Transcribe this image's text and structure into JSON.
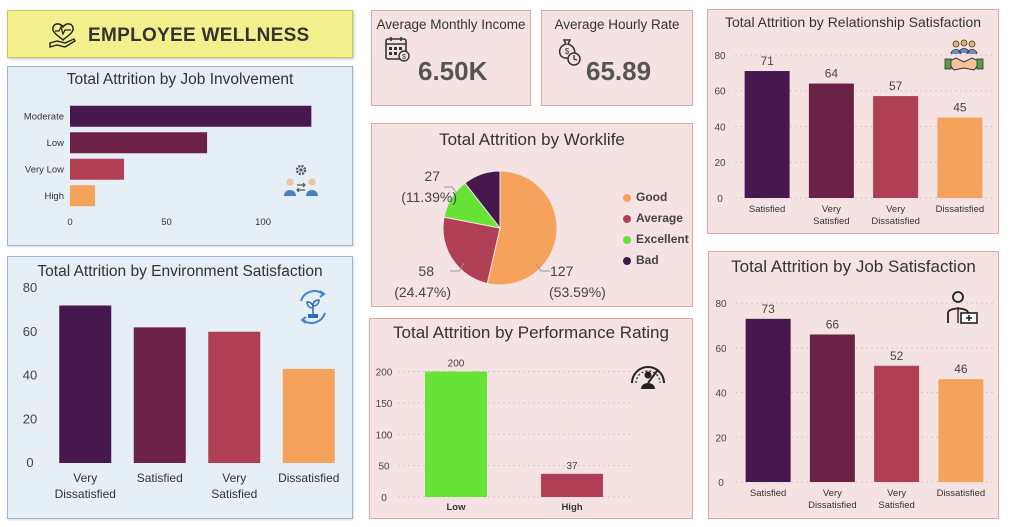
{
  "header": {
    "title": "EMPLOYEE WELLNESS",
    "icon": "heart-hand-icon"
  },
  "colors": {
    "c1": "#46184e",
    "c2": "#6b2244",
    "c3": "#b03e55",
    "c4": "#f4a25c",
    "green": "#66e334",
    "lime": "#66e334"
  },
  "kpis": {
    "income": {
      "label": "Average Monthly Income",
      "value": "6.50K",
      "icon": "calendar-money-icon"
    },
    "hourly": {
      "label": "Average Hourly Rate",
      "value": "65.89",
      "icon": "money-bag-clock-icon"
    }
  },
  "chart_data": [
    {
      "id": "job_involvement",
      "type": "bar",
      "orientation": "horizontal",
      "title": "Total Attrition by Job Involvement",
      "categories": [
        "Moderate",
        "Low",
        "Very Low",
        "High"
      ],
      "values": [
        125,
        71,
        28,
        13
      ],
      "xlim": [
        0,
        130
      ],
      "xticks": [
        0,
        50,
        100
      ],
      "icon": "team-gear-icon"
    },
    {
      "id": "environment",
      "type": "bar",
      "title": "Total Attrition by Environment Satisfaction",
      "categories": [
        "Very Dissatisfied",
        "Satisfied",
        "Very Satisfied",
        "Dissatisfied"
      ],
      "values": [
        72,
        62,
        60,
        43
      ],
      "ylim": [
        0,
        80
      ],
      "yticks": [
        0,
        20,
        40,
        60,
        80
      ],
      "icon": "plant-cycle-icon"
    },
    {
      "id": "worklife",
      "type": "pie",
      "title": "Total Attrition by Worklife",
      "slices": [
        {
          "name": "Good",
          "value": 127,
          "pct": "(53.59%)"
        },
        {
          "name": "Average",
          "value": 58,
          "pct": "(24.47%)"
        },
        {
          "name": "Excellent",
          "value": 27,
          "pct": "(11.39%)"
        },
        {
          "name": "Bad",
          "value": 25,
          "pct": ""
        }
      ],
      "legend_position": "right"
    },
    {
      "id": "performance",
      "type": "bar",
      "title": "Total Attrition by Performance Rating",
      "categories": [
        "Low",
        "High"
      ],
      "values": [
        200,
        37
      ],
      "ylim": [
        0,
        220
      ],
      "yticks": [
        0,
        50,
        100,
        150,
        200
      ],
      "icon": "gauge-icon"
    },
    {
      "id": "relationship",
      "type": "bar",
      "title": "Total Attrition by Relationship Satisfaction",
      "categories": [
        "Satisfied",
        "Very Satisfied",
        "Very Dissatisfied",
        "Dissatisfied"
      ],
      "values": [
        71,
        64,
        57,
        45
      ],
      "ylim": [
        0,
        85
      ],
      "yticks": [
        0,
        20,
        40,
        60,
        80
      ],
      "icon": "handshake-icon"
    },
    {
      "id": "job_satisfaction",
      "type": "bar",
      "title": "Total Attrition by Job Satisfaction",
      "categories": [
        "Satisfied",
        "Very Dissatisfied",
        "Very Satisfied",
        "Dissatisfied"
      ],
      "values": [
        73,
        66,
        52,
        46
      ],
      "ylim": [
        0,
        85
      ],
      "yticks": [
        0,
        20,
        40,
        60,
        80
      ],
      "icon": "doctor-icon"
    }
  ]
}
